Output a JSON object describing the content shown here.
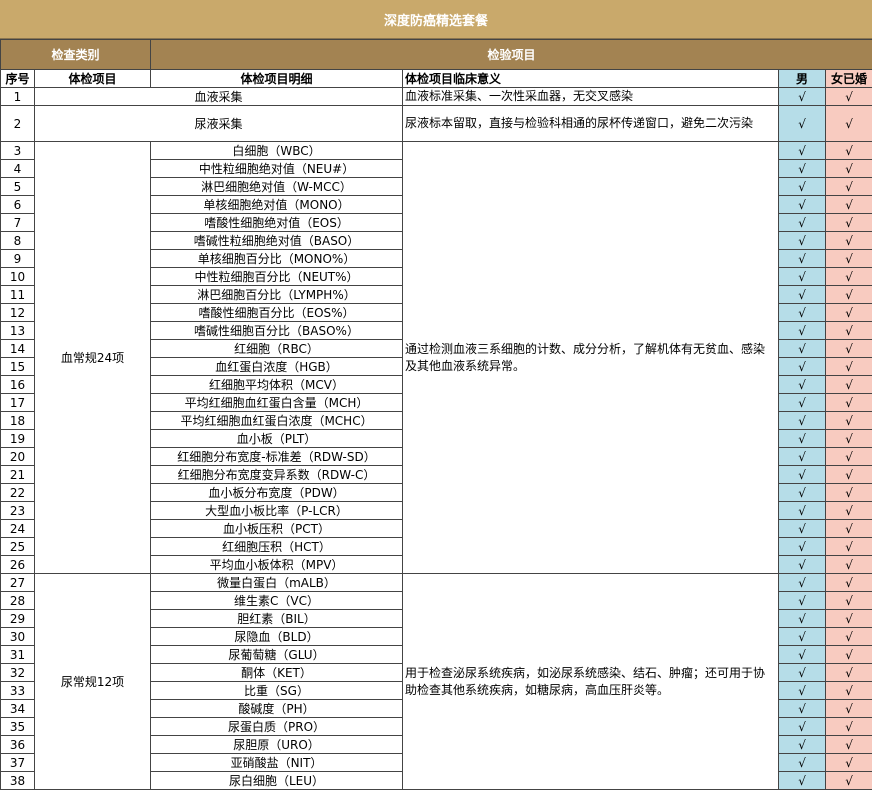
{
  "title": "深度防癌精选套餐",
  "header": {
    "category": "检查类别",
    "items": "检验项目"
  },
  "columns": {
    "no": "序号",
    "exam_item": "体检项目",
    "detail": "体检项目明细",
    "significance": "体检项目临床意义",
    "male": "男",
    "female": "女已婚"
  },
  "check": "√",
  "special_rows": [
    {
      "no": "1",
      "name": "血液采集",
      "significance": "血液标准采集、一次性采血器，无交叉感染"
    },
    {
      "no": "2",
      "name": "尿液采集",
      "significance": "尿液标本留取，直接与检验科相通的尿杯传递窗口，避免二次污染"
    }
  ],
  "groups": [
    {
      "name": "血常规24项",
      "significance": "通过检测血液三系细胞的计数、成分分析，了解机体有无贫血、感染及其他血液系统异常。",
      "rows": [
        {
          "no": "3",
          "detail": "白细胞（WBC）"
        },
        {
          "no": "4",
          "detail": "中性粒细胞绝对值（NEU#）"
        },
        {
          "no": "5",
          "detail": "淋巴细胞绝对值（W-MCC）"
        },
        {
          "no": "6",
          "detail": "单核细胞绝对值（MONO）"
        },
        {
          "no": "7",
          "detail": "嗜酸性细胞绝对值（EOS）"
        },
        {
          "no": "8",
          "detail": "嗜碱性粒细胞绝对值（BASO）"
        },
        {
          "no": "9",
          "detail": "单核细胞百分比（MONO%）"
        },
        {
          "no": "10",
          "detail": "中性粒细胞百分比（NEUT%）"
        },
        {
          "no": "11",
          "detail": "淋巴细胞百分比（LYMPH%）"
        },
        {
          "no": "12",
          "detail": "嗜酸性细胞百分比（EOS%）"
        },
        {
          "no": "13",
          "detail": "嗜碱性细胞百分比（BASO%）"
        },
        {
          "no": "14",
          "detail": "红细胞（RBC）"
        },
        {
          "no": "15",
          "detail": "血红蛋白浓度（HGB）"
        },
        {
          "no": "16",
          "detail": "红细胞平均体积（MCV）"
        },
        {
          "no": "17",
          "detail": "平均红细胞血红蛋白含量（MCH）"
        },
        {
          "no": "18",
          "detail": "平均红细胞血红蛋白浓度（MCHC）"
        },
        {
          "no": "19",
          "detail": "血小板（PLT）"
        },
        {
          "no": "20",
          "detail": "红细胞分布宽度-标准差（RDW-SD）"
        },
        {
          "no": "21",
          "detail": "红细胞分布宽度变异系数（RDW-C）"
        },
        {
          "no": "22",
          "detail": "血小板分布宽度（PDW）"
        },
        {
          "no": "23",
          "detail": "大型血小板比率（P-LCR）"
        },
        {
          "no": "24",
          "detail": "血小板压积（PCT）"
        },
        {
          "no": "25",
          "detail": "红细胞压积（HCT）"
        },
        {
          "no": "26",
          "detail": "平均血小板体积（MPV）"
        }
      ]
    },
    {
      "name": "尿常规12项",
      "significance": "用于检查泌尿系统疾病，如泌尿系统感染、结石、肿瘤；还可用于协助检查其他系统疾病，如糖尿病，高血压肝炎等。",
      "rows": [
        {
          "no": "27",
          "detail": "微量白蛋白（mALB）"
        },
        {
          "no": "28",
          "detail": "维生素C（VC）"
        },
        {
          "no": "29",
          "detail": "胆红素（BIL）"
        },
        {
          "no": "30",
          "detail": "尿隐血（BLD）"
        },
        {
          "no": "31",
          "detail": "尿葡萄糖（GLU）"
        },
        {
          "no": "32",
          "detail": "酮体（KET）"
        },
        {
          "no": "33",
          "detail": "比重（SG）"
        },
        {
          "no": "34",
          "detail": "酸碱度（PH）"
        },
        {
          "no": "35",
          "detail": "尿蛋白质（PRO）"
        },
        {
          "no": "36",
          "detail": "尿胆原（URO）"
        },
        {
          "no": "37",
          "detail": "亚硝酸盐（NIT）"
        },
        {
          "no": "38",
          "detail": "尿白细胞（LEU）"
        }
      ]
    }
  ],
  "colors": {
    "banner": "#c9a96b",
    "header": "#a38352",
    "male": "#b6dde8",
    "female": "#f8cbc0"
  }
}
